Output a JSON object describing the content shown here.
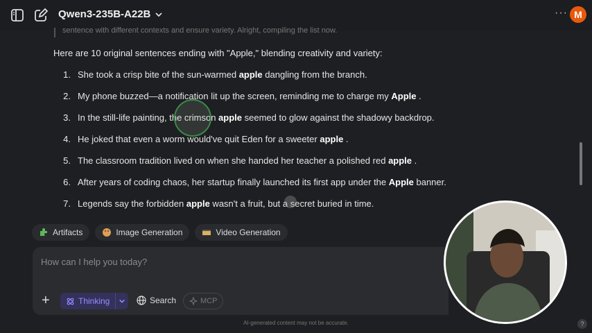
{
  "header": {
    "model_name": "Qwen3-235B-A22B",
    "more_label": "···",
    "avatar_initial": "M"
  },
  "thinking_tail": "sentence with different contexts and ensure variety. Alright, compiling the list now.",
  "intro": "Here are 10 original sentences ending with \"Apple,\" blending creativity and variety:",
  "items": [
    {
      "num": "1.",
      "pre": "She took a crisp bite of the sun-warmed ",
      "bold": "apple",
      "post": " dangling from the branch."
    },
    {
      "num": "2.",
      "pre": "My phone buzzed—a notification lit up the screen, reminding me to charge my ",
      "bold": "Apple",
      "post": " ."
    },
    {
      "num": "3.",
      "pre": "In the still-life painting, the crimson ",
      "bold": "apple",
      "post": " seemed to glow against the shadowy backdrop."
    },
    {
      "num": "4.",
      "pre": "He joked that even a worm would've quit Eden for a sweeter ",
      "bold": "apple",
      "post": " ."
    },
    {
      "num": "5.",
      "pre": "The classroom tradition lived on when she handed her teacher a polished red ",
      "bold": "apple",
      "post": " ."
    },
    {
      "num": "6.",
      "pre": "After years of coding chaos, her startup finally launched its first app under the ",
      "bold": "Apple",
      "post": " banner."
    },
    {
      "num": "7.",
      "pre": "Legends say the forbidden ",
      "bold": "apple",
      "post": " wasn't a fruit, but a secret buried in time."
    }
  ],
  "chips": [
    "Artifacts",
    "Image Generation",
    "Video Generation"
  ],
  "input": {
    "placeholder": "How can I help you today?",
    "thinking_label": "Thinking",
    "search_label": "Search",
    "mcp_label": "MCP"
  },
  "footer": "AI-generated content may not be accurate.",
  "help_label": "?",
  "colors": {
    "accent": "#9b8cff",
    "avatar": "#e8590c",
    "background": "#1e1f22"
  }
}
